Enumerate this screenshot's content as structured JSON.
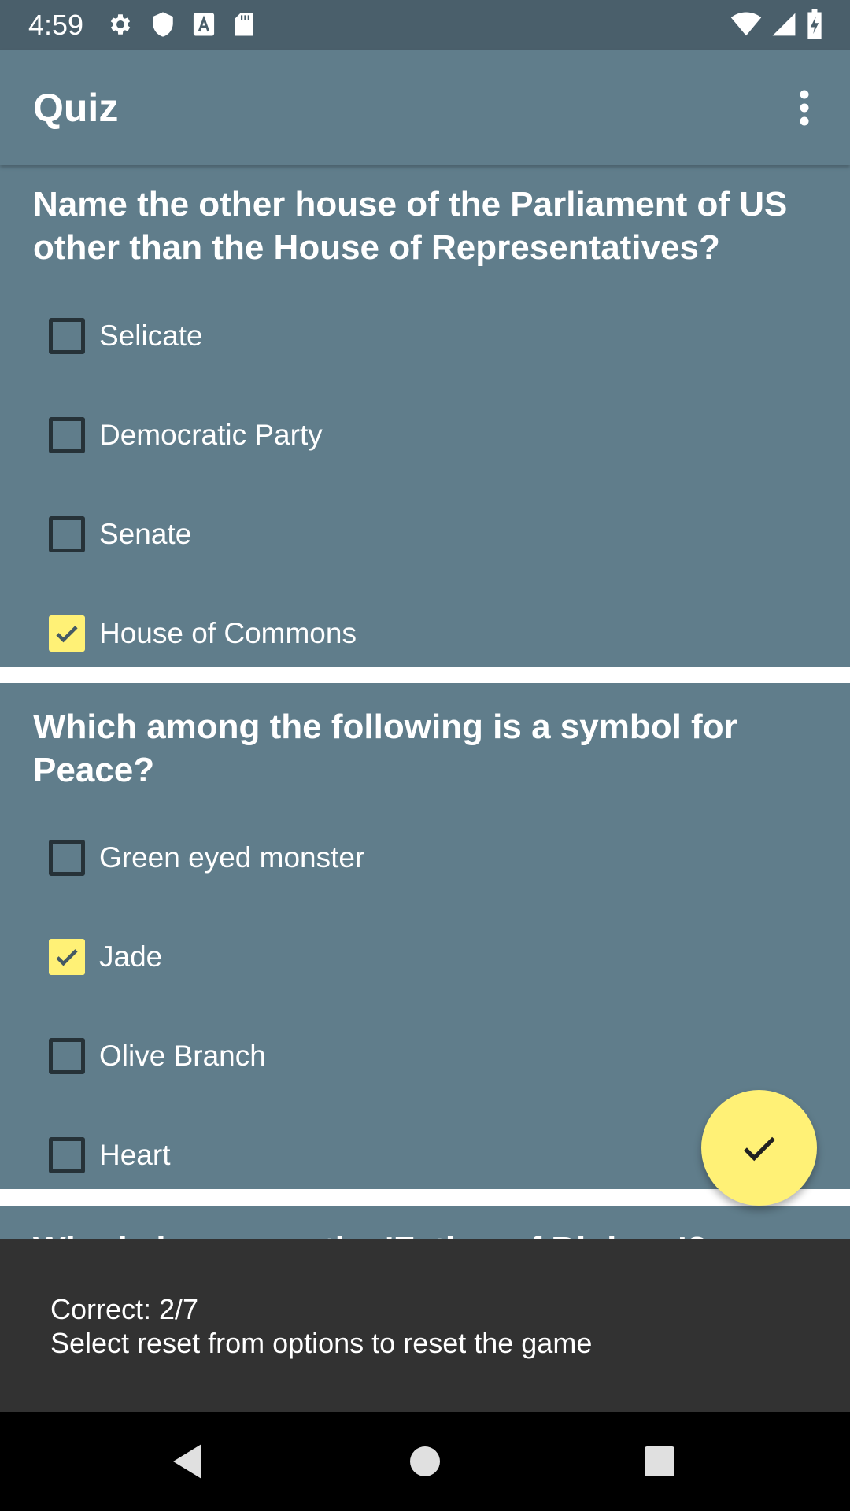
{
  "status_bar": {
    "time": "4:59",
    "left_icons": [
      "gear-icon",
      "shield-icon",
      "font-a-icon",
      "sd-card-icon"
    ],
    "right_icons": [
      "wifi-icon",
      "signal-icon",
      "battery-charging-icon"
    ]
  },
  "app_bar": {
    "title": "Quiz",
    "overflow_icon": "more-vert-icon"
  },
  "questions": [
    {
      "text": "Name the other house of the Parliament of US other than the House of Representatives?",
      "options": [
        {
          "label": "Selicate",
          "checked": false
        },
        {
          "label": "Democratic Party",
          "checked": false
        },
        {
          "label": "Senate",
          "checked": false
        },
        {
          "label": "House of Commons",
          "checked": true
        }
      ]
    },
    {
      "text": "Which among the following is a symbol for Peace?",
      "options": [
        {
          "label": "Green eyed monster",
          "checked": false
        },
        {
          "label": "Jade",
          "checked": true
        },
        {
          "label": "Olive Branch",
          "checked": false
        },
        {
          "label": "Heart",
          "checked": false
        }
      ]
    }
  ],
  "partial_question": "Who is known as the 'Father of Biology'?",
  "fab": {
    "icon": "check-icon"
  },
  "snackbar": {
    "line1": "Correct: 2/7",
    "line2": "Select reset from options to reset the game"
  },
  "nav_bar": {
    "icons": [
      "back-icon",
      "home-icon",
      "recents-icon"
    ]
  },
  "colors": {
    "status_bar": "#4a5f6b",
    "primary": "#607d8b",
    "accent": "#fff176",
    "snackbar": "#323232",
    "checkbox_border": "#263238"
  }
}
